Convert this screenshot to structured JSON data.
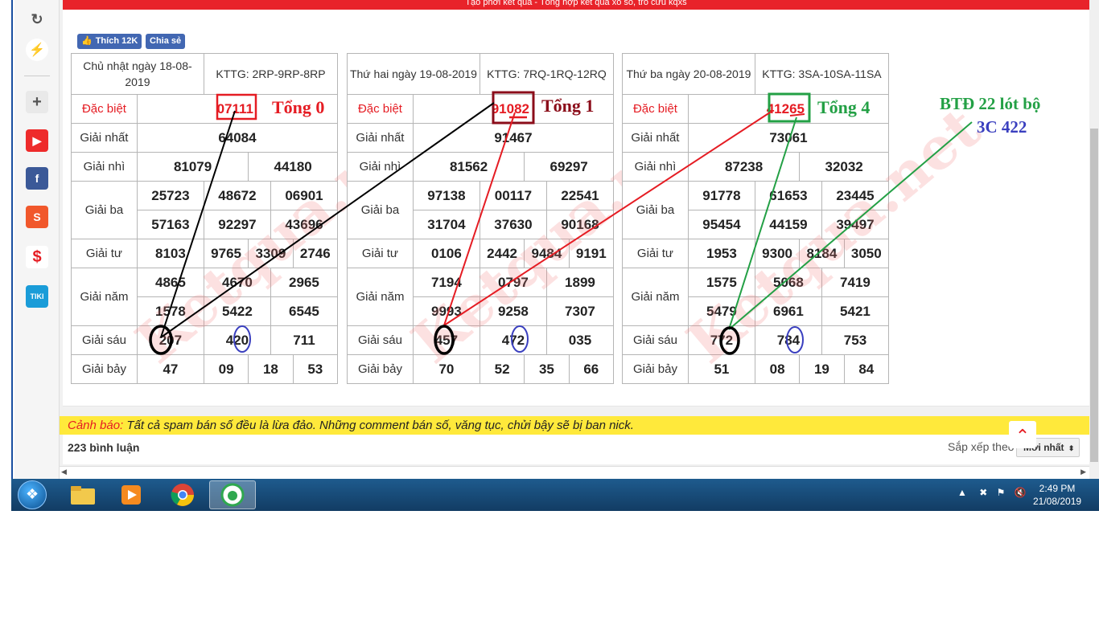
{
  "page_banner": "Tạo phơi kết quả - Tổng hợp kết quả xổ số, trò cứu kqxs",
  "social": {
    "like_label": "Thích 12K",
    "share_label": "Chia sẻ"
  },
  "watermark": "Ketqua.net",
  "tables": [
    {
      "header_date": "Chủ nhật ngày 18-08-2019",
      "header_kttg": "KTTG: 2RP-9RP-8RP",
      "dac_biet": "07111",
      "giai_nhat": "64084",
      "giai_nhi": [
        "81079",
        "44180"
      ],
      "giai_ba": [
        "25723",
        "48672",
        "06901",
        "57163",
        "92297",
        "43696"
      ],
      "giai_tu": [
        "8103",
        "9765",
        "3309",
        "2746"
      ],
      "giai_nam": [
        "4865",
        "4670",
        "2965",
        "1578",
        "5422",
        "6545"
      ],
      "giai_sau": [
        "207",
        "420",
        "711"
      ],
      "giai_bay": [
        "47",
        "09",
        "18",
        "53"
      ],
      "note": "Tổng 0"
    },
    {
      "header_date": "Thứ hai ngày 19-08-2019",
      "header_kttg": "KTTG: 7RQ-1RQ-12RQ",
      "dac_biet": "91082",
      "giai_nhat": "91467",
      "giai_nhi": [
        "81562",
        "69297"
      ],
      "giai_ba": [
        "97138",
        "00117",
        "22541",
        "31704",
        "37630",
        "90168"
      ],
      "giai_tu": [
        "0106",
        "2442",
        "9484",
        "9191"
      ],
      "giai_nam": [
        "7194",
        "0797",
        "1899",
        "9993",
        "9258",
        "7307"
      ],
      "giai_sau": [
        "457",
        "472",
        "035"
      ],
      "giai_bay": [
        "70",
        "52",
        "35",
        "66"
      ],
      "note": "Tổng 1"
    },
    {
      "header_date": "Thứ ba ngày 20-08-2019",
      "header_kttg": "KTTG: 3SA-10SA-11SA",
      "dac_biet": "41265",
      "giai_nhat": "73061",
      "giai_nhi": [
        "87238",
        "32032"
      ],
      "giai_ba": [
        "91778",
        "61653",
        "23445",
        "95454",
        "44159",
        "39497"
      ],
      "giai_tu": [
        "1953",
        "9300",
        "8184",
        "3050"
      ],
      "giai_nam": [
        "1575",
        "5068",
        "7419",
        "5479",
        "6961",
        "5421"
      ],
      "giai_sau": [
        "772",
        "784",
        "753"
      ],
      "giai_bay": [
        "51",
        "08",
        "19",
        "84"
      ],
      "note": "Tổng 4"
    }
  ],
  "labels": {
    "dac_biet": "Đặc biệt",
    "giai_nhat": "Giải nhất",
    "giai_nhi": "Giải nhì",
    "giai_ba": "Giải ba",
    "giai_tu": "Giải tư",
    "giai_nam": "Giải năm",
    "giai_sau": "Giải sáu",
    "giai_bay": "Giải bảy"
  },
  "annotation": {
    "line1": "BTĐ 22 lót bộ",
    "line2": "3C 422"
  },
  "warning": {
    "label": "Cảnh báo:",
    "text": " Tất cả spam bán số đều là lừa đảo. Những comment bán số, văng tục, chửi bậy sẽ bị ban nick."
  },
  "comments": {
    "count": "223 bình luận",
    "sort_label": "Sắp xếp theo",
    "sort_value": "Mới nhất"
  },
  "clock": {
    "time": "2:49 PM",
    "date": "21/08/2019"
  },
  "colors": {
    "red": "#e51c23",
    "darkred": "#8b0d1a",
    "green": "#23a045",
    "blue": "#3a3fbf",
    "black": "#000000"
  }
}
